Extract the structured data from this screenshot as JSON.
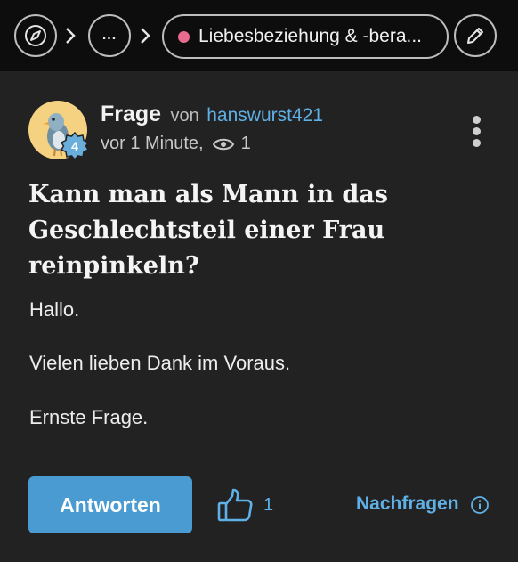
{
  "topbar": {
    "compass_label": "compass-icon",
    "more_label": "...",
    "category_label": "Liebesbeziehung & -bera...",
    "category_color": "#e86a8f",
    "edit_label": "pencil-icon"
  },
  "post": {
    "type_label": "Frage",
    "by_label": "von",
    "author": "hanswurst421",
    "time": "vor 1 Minute,",
    "views": "1",
    "author_level": "4",
    "title": "Kann man als Mann in das Geschlechtsteil einer Frau reinpinkeln?",
    "body": [
      "Hallo.",
      "Vielen lieben Dank im Voraus.",
      "Ernste Frage."
    ]
  },
  "actions": {
    "answer_label": "Antworten",
    "like_count": "1",
    "ask_label": "Nachfragen"
  },
  "colors": {
    "accent": "#4a9bd2",
    "link": "#5fb0e6",
    "background": "#222222",
    "topbar": "#0d0d0d"
  }
}
